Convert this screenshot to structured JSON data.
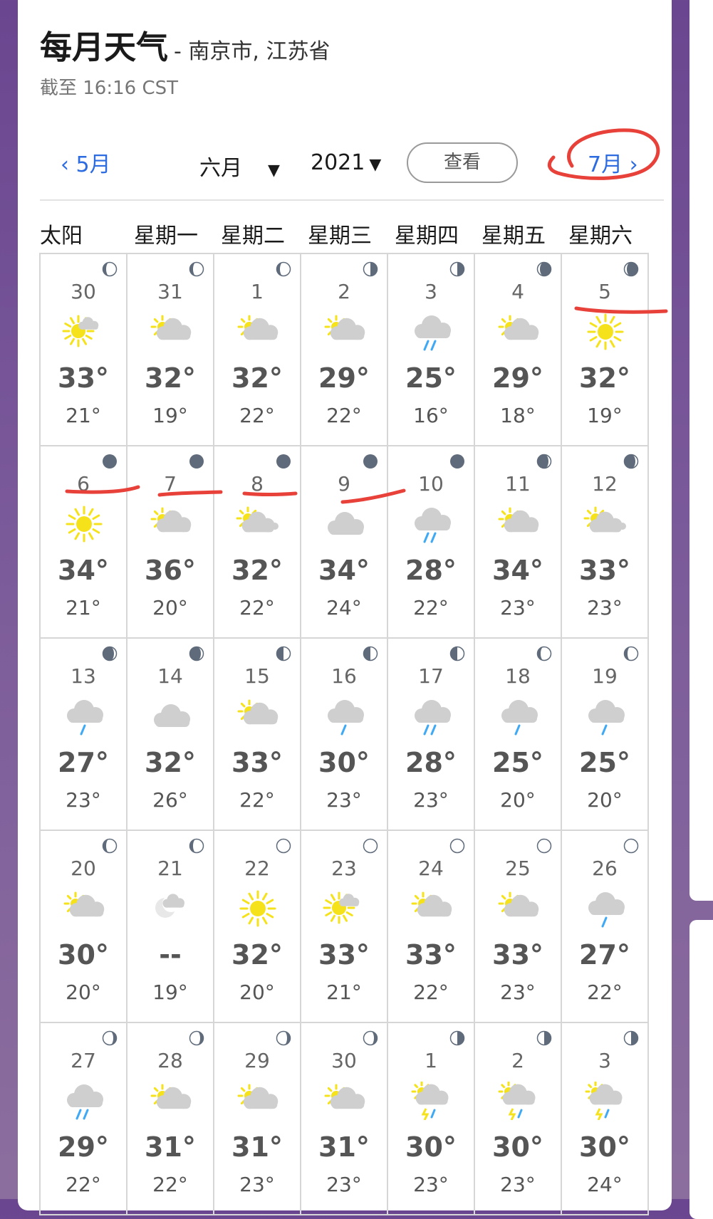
{
  "header": {
    "title": "每月天气",
    "subtitle": "- 南京市, 江苏省",
    "updated": "截至 16:16 CST"
  },
  "nav": {
    "prev_label": "5月",
    "next_label": "7月",
    "month_selected": "六月",
    "year_selected": "2021",
    "view_button": "查看"
  },
  "weekdays": [
    "太阳",
    "星期一",
    "星期二",
    "星期三",
    "星期四",
    "星期五",
    "星期六"
  ],
  "colors": {
    "accent_link": "#2c6be0",
    "annotation_red": "#e8413a",
    "sun_yellow": "#f5e21b",
    "cloud_gray": "#cfcfcf",
    "rain_blue": "#3fa9f5"
  },
  "days": [
    {
      "day": "30",
      "hi": "33°",
      "lo": "21°",
      "icon": "sun-behind-small-cloud-icon",
      "moon": "waxing-gibbous"
    },
    {
      "day": "31",
      "hi": "32°",
      "lo": "19°",
      "icon": "partly-cloudy-icon",
      "moon": "waxing-gibbous"
    },
    {
      "day": "1",
      "hi": "32°",
      "lo": "22°",
      "icon": "partly-cloudy-icon",
      "moon": "waxing-gibbous"
    },
    {
      "day": "2",
      "hi": "29°",
      "lo": "22°",
      "icon": "partly-cloudy-icon",
      "moon": "last-quarter"
    },
    {
      "day": "3",
      "hi": "25°",
      "lo": "16°",
      "icon": "rain-cloud-icon",
      "moon": "last-quarter"
    },
    {
      "day": "4",
      "hi": "29°",
      "lo": "18°",
      "icon": "partly-cloudy-icon",
      "moon": "waning-crescent"
    },
    {
      "day": "5",
      "hi": "32°",
      "lo": "19°",
      "icon": "sunny-icon",
      "moon": "waning-crescent"
    },
    {
      "day": "6",
      "hi": "34°",
      "lo": "21°",
      "icon": "sunny-icon",
      "moon": "new"
    },
    {
      "day": "7",
      "hi": "36°",
      "lo": "20°",
      "icon": "partly-cloudy-icon",
      "moon": "new"
    },
    {
      "day": "8",
      "hi": "32°",
      "lo": "22°",
      "icon": "sun-with-clouds-icon",
      "moon": "new"
    },
    {
      "day": "9",
      "hi": "34°",
      "lo": "24°",
      "icon": "cloudy-icon",
      "moon": "new"
    },
    {
      "day": "10",
      "hi": "28°",
      "lo": "22°",
      "icon": "rain-cloud-icon",
      "moon": "new"
    },
    {
      "day": "11",
      "hi": "34°",
      "lo": "23°",
      "icon": "partly-cloudy-icon",
      "moon": "waxing-crescent"
    },
    {
      "day": "12",
      "hi": "33°",
      "lo": "23°",
      "icon": "sun-with-clouds-icon",
      "moon": "waxing-crescent"
    },
    {
      "day": "13",
      "hi": "27°",
      "lo": "23°",
      "icon": "light-rain-cloud-icon",
      "moon": "waxing-crescent"
    },
    {
      "day": "14",
      "hi": "32°",
      "lo": "26°",
      "icon": "cloudy-icon",
      "moon": "waxing-crescent"
    },
    {
      "day": "15",
      "hi": "33°",
      "lo": "22°",
      "icon": "partly-cloudy-icon",
      "moon": "first-quarter"
    },
    {
      "day": "16",
      "hi": "30°",
      "lo": "23°",
      "icon": "light-rain-cloud-icon",
      "moon": "first-quarter"
    },
    {
      "day": "17",
      "hi": "28°",
      "lo": "23°",
      "icon": "rain-cloud-icon",
      "moon": "first-quarter"
    },
    {
      "day": "18",
      "hi": "25°",
      "lo": "20°",
      "icon": "light-rain-cloud-icon",
      "moon": "waxing-gibbous"
    },
    {
      "day": "19",
      "hi": "25°",
      "lo": "20°",
      "icon": "light-rain-cloud-icon",
      "moon": "waxing-gibbous"
    },
    {
      "day": "20",
      "hi": "30°",
      "lo": "20°",
      "icon": "partly-cloudy-icon",
      "moon": "waxing-gibbous"
    },
    {
      "day": "21",
      "hi": "--",
      "lo": "19°",
      "icon": "moon-with-clouds-icon",
      "moon": "waxing-gibbous"
    },
    {
      "day": "22",
      "hi": "32°",
      "lo": "20°",
      "icon": "sunny-icon",
      "moon": "full"
    },
    {
      "day": "23",
      "hi": "33°",
      "lo": "21°",
      "icon": "sun-behind-small-cloud-icon",
      "moon": "full"
    },
    {
      "day": "24",
      "hi": "33°",
      "lo": "22°",
      "icon": "partly-cloudy-icon",
      "moon": "full"
    },
    {
      "day": "25",
      "hi": "33°",
      "lo": "23°",
      "icon": "partly-cloudy-icon",
      "moon": "full"
    },
    {
      "day": "26",
      "hi": "27°",
      "lo": "22°",
      "icon": "light-rain-cloud-icon",
      "moon": "full"
    },
    {
      "day": "27",
      "hi": "29°",
      "lo": "22°",
      "icon": "rain-cloud-icon",
      "moon": "waning-gibbous"
    },
    {
      "day": "28",
      "hi": "31°",
      "lo": "22°",
      "icon": "partly-cloudy-icon",
      "moon": "waning-gibbous"
    },
    {
      "day": "29",
      "hi": "31°",
      "lo": "23°",
      "icon": "partly-cloudy-icon",
      "moon": "waning-gibbous"
    },
    {
      "day": "30",
      "hi": "31°",
      "lo": "23°",
      "icon": "partly-cloudy-icon",
      "moon": "waning-gibbous"
    },
    {
      "day": "1",
      "hi": "30°",
      "lo": "23°",
      "icon": "thunderstorm-icon",
      "moon": "last-quarter"
    },
    {
      "day": "2",
      "hi": "30°",
      "lo": "23°",
      "icon": "thunderstorm-icon",
      "moon": "last-quarter"
    },
    {
      "day": "3",
      "hi": "30°",
      "lo": "24°",
      "icon": "thunderstorm-icon",
      "moon": "last-quarter"
    }
  ]
}
